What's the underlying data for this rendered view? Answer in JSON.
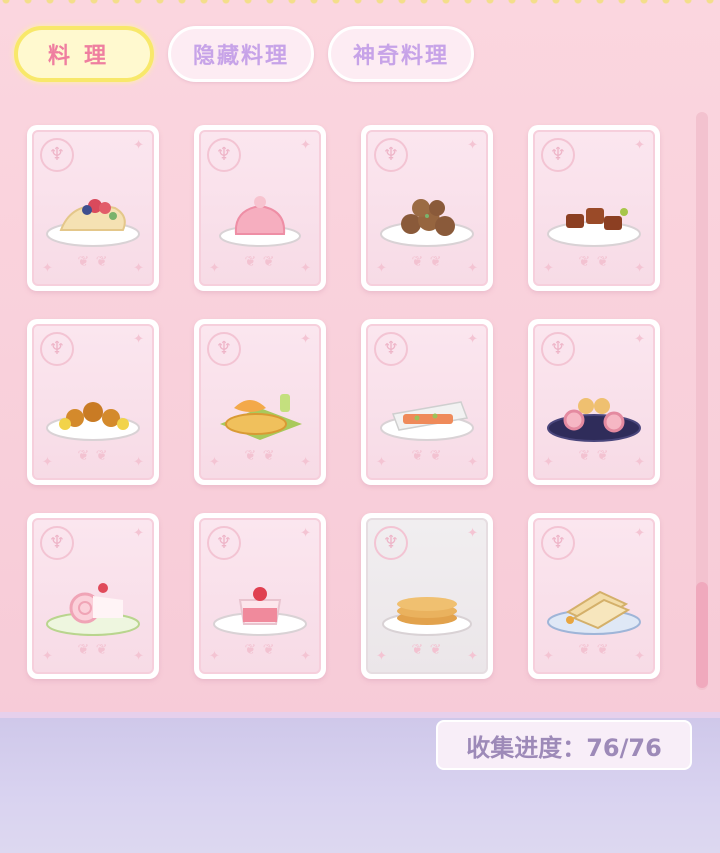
{
  "tabs": [
    {
      "label": "料理"
    },
    {
      "label": "隐藏料理"
    },
    {
      "label": "神奇料理"
    }
  ],
  "progress": {
    "text": "收集进度：76/76"
  },
  "cards": [
    {
      "dish": "taco-fruit"
    },
    {
      "dish": "strawberry-jelly"
    },
    {
      "dish": "meatballs"
    },
    {
      "dish": "braised-pork"
    },
    {
      "dish": "lemon-chicken"
    },
    {
      "dish": "fish-platter"
    },
    {
      "dish": "salmon-toast"
    },
    {
      "dish": "swiss-rolls"
    },
    {
      "dish": "strawberry-roll-cake"
    },
    {
      "dish": "strawberry-pudding"
    },
    {
      "dish": "pancakes"
    },
    {
      "dish": "toast-sandwich"
    }
  ],
  "icons": {
    "badge": "fork-spoon-icon",
    "sparkle": "sparkle-icon",
    "laurel": "laurel-icon"
  },
  "colors": {
    "active_tab_text": "#ef7fa0",
    "inactive_tab_text": "#c7a3e8",
    "progress_text": "#9d8ab8"
  }
}
